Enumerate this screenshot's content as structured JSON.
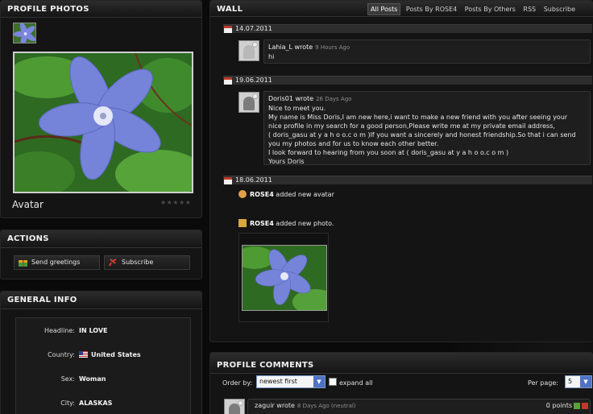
{
  "profile_photos": {
    "title": "PROFILE PHOTOS",
    "avatar_label": "Avatar",
    "rating_stars": "★★★★★",
    "rating_value": 0
  },
  "actions": {
    "title": "ACTIONS",
    "send_greetings": "Send greetings",
    "subscribe": "Subscribe"
  },
  "general_info": {
    "title": "GENERAL INFO",
    "rows": [
      {
        "key": "Headline:",
        "value": "IN LOVE"
      },
      {
        "key": "Country:",
        "value": "United States"
      },
      {
        "key": "Sex:",
        "value": "Woman"
      },
      {
        "key": "City:",
        "value": "ALASKAS"
      }
    ]
  },
  "wall": {
    "title": "WALL",
    "tabs": [
      {
        "label": "All Posts",
        "active": true
      },
      {
        "label": "Posts By ROSE4",
        "active": false
      },
      {
        "label": "Posts By Others",
        "active": false
      },
      {
        "label": "RSS",
        "active": false
      },
      {
        "label": "Subscribe",
        "active": false
      }
    ],
    "entries": [
      {
        "date": "14.07.2011",
        "author": "Lahia_L wrote",
        "ago": "9 Hours Ago",
        "lines": [
          "hi"
        ]
      },
      {
        "date": "19.06.2011",
        "author": "Doris01 wrote",
        "ago": "26 Days Ago",
        "lines": [
          "Nice to meet you.",
          "My name is Miss Doris,I am new here,i want to make a new friend with you after seeing your",
          "nice profile in my search for a good person,Please write me at my private email address,",
          "( doris_gasu at y a h o o.c o m )If you want a sincerely and honest friendship.So that i can send",
          "you my photos and for us to know each other better.",
          "I look forward to hearing from you soon at ( doris_gasu at y a h o o.c o m )",
          "Yours Doris"
        ]
      },
      {
        "date": "18.06.2011",
        "activities": [
          {
            "user": "ROSE4",
            "text": " added new avatar"
          },
          {
            "user": "ROSE4",
            "text": " added new photo."
          }
        ]
      }
    ]
  },
  "comments": {
    "title": "PROFILE COMMENTS",
    "order_label": "Order by:",
    "order_value": "newest first",
    "expand_label": "expand all",
    "per_page_label": "Per page:",
    "per_page_value": "5",
    "first_comment": {
      "author": "zaguir wrote",
      "ago": "8 Days Ago (neutral)",
      "points": "0 points"
    }
  },
  "colors": {
    "background": "#0b0b0b",
    "panel": "#141414",
    "header": "#2c2c2c",
    "flower_petal": "#6f7fd8",
    "leaf": "#3f8a2c"
  }
}
